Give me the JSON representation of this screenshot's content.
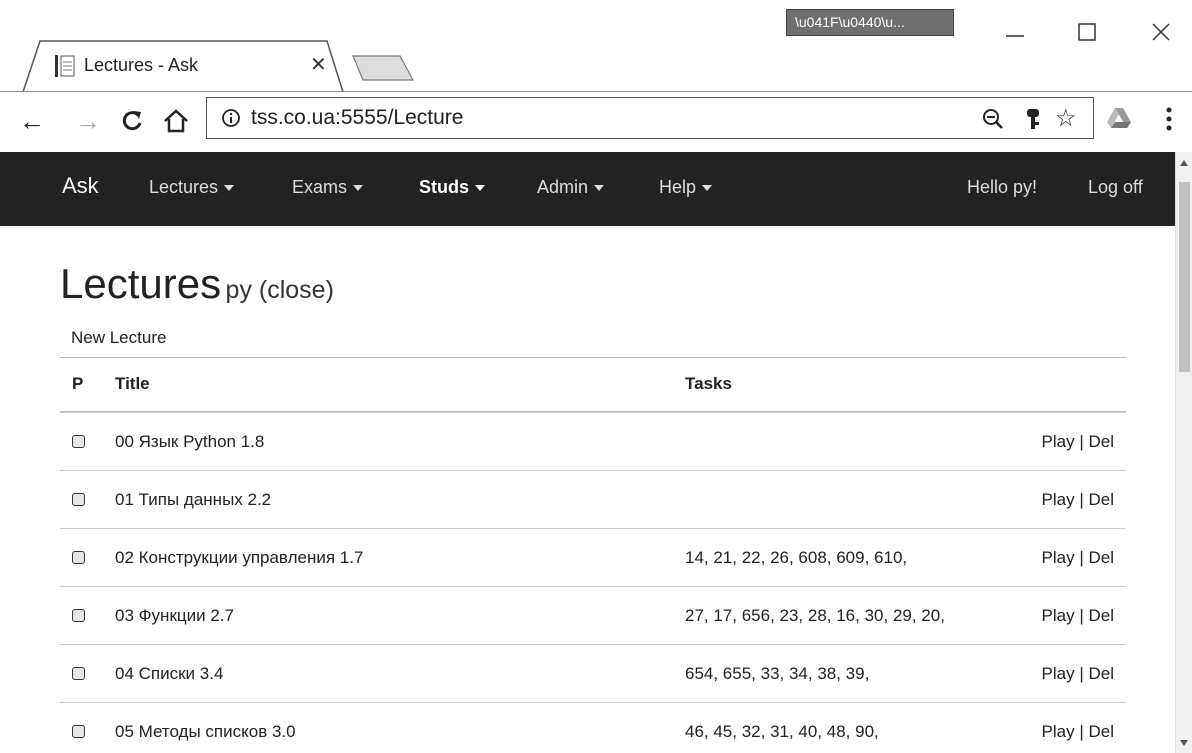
{
  "window": {
    "tab_title": "Lectures - Ask",
    "badge_text": "\\u041F\\u0440\\u...",
    "url": "tss.co.ua:5555/Lecture"
  },
  "navbar": {
    "brand": "Ask",
    "items": [
      {
        "label": "Lectures"
      },
      {
        "label": "Exams"
      },
      {
        "label": "Studs"
      },
      {
        "label": "Admin"
      },
      {
        "label": "Help"
      }
    ],
    "greeting": "Hello py!",
    "logoff": "Log off"
  },
  "page": {
    "title": "Lectures",
    "subtitle": "py (close)",
    "new_lecture": "New Lecture"
  },
  "table": {
    "headers": {
      "p": "P",
      "title": "Title",
      "tasks": "Tasks"
    },
    "play_label": "Play",
    "del_label": "Del",
    "rows": [
      {
        "title": "00 Язык Python  1.8",
        "tasks": ""
      },
      {
        "title": "01 Типы данных  2.2",
        "tasks": ""
      },
      {
        "title": "02 Конструкции управления  1.7",
        "tasks": "14, 21, 22, 26, 608, 609, 610,"
      },
      {
        "title": "03 Функции  2.7",
        "tasks": "27, 17, 656, 23, 28, 16, 30, 29, 20,"
      },
      {
        "title": "04 Списки  3.4",
        "tasks": "654, 655, 33, 34, 38, 39,"
      },
      {
        "title": "05 Методы списков  3.0",
        "tasks": "46, 45, 32, 31, 40, 48, 90,"
      }
    ]
  }
}
